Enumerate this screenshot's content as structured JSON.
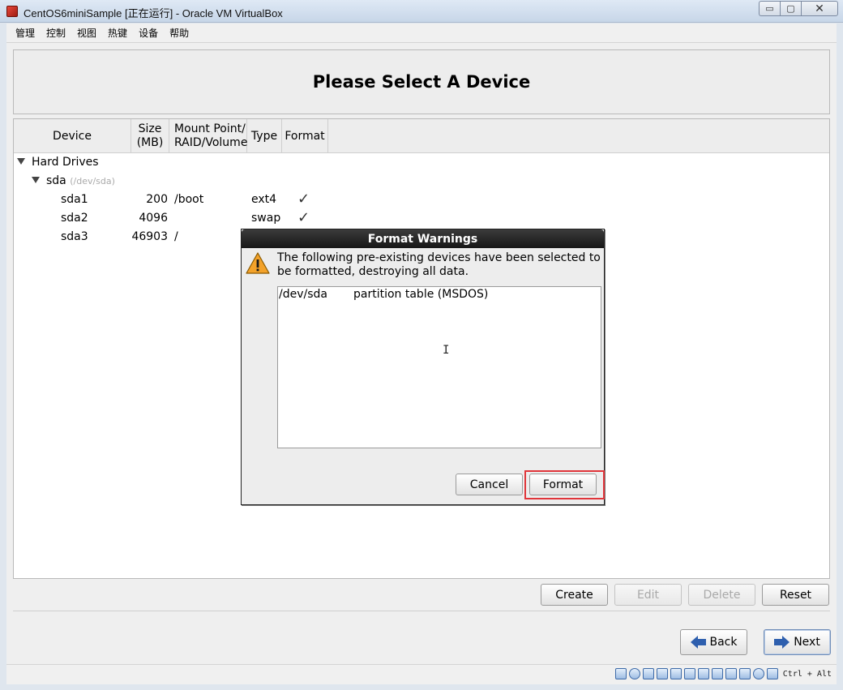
{
  "window": {
    "title": "CentOS6miniSample [正在运行] - Oracle VM VirtualBox",
    "minimize_glyph": "▭",
    "maximize_glyph": "▢",
    "close_glyph": "✕"
  },
  "menubar": {
    "items": [
      "管理",
      "控制",
      "视图",
      "热键",
      "设备",
      "帮助"
    ]
  },
  "header": {
    "title": "Please Select A Device"
  },
  "table": {
    "columns": {
      "device": "Device",
      "size": "Size\n(MB)",
      "mount": "Mount Point/\nRAID/Volume",
      "type": "Type",
      "format": "Format"
    },
    "group": "Hard Drives",
    "disk": {
      "name": "sda",
      "path": "(/dev/sda)"
    },
    "partitions": [
      {
        "name": "sda1",
        "size": "200",
        "mount": "/boot",
        "type": "ext4",
        "format": "✓"
      },
      {
        "name": "sda2",
        "size": "4096",
        "mount": "",
        "type": "swap",
        "format": "✓"
      },
      {
        "name": "sda3",
        "size": "46903",
        "mount": "/",
        "type": "",
        "format": ""
      }
    ]
  },
  "actions": {
    "create": "Create",
    "edit": "Edit",
    "delete": "Delete",
    "reset": "Reset"
  },
  "nav": {
    "back": "Back",
    "next": "Next"
  },
  "dialog": {
    "title": "Format Warnings",
    "message": "The following pre-existing devices have been selected to be formatted, destroying all data.",
    "list": [
      {
        "device": "/dev/sda",
        "description": "partition table (MSDOS)"
      }
    ],
    "cancel": "Cancel",
    "format": "Format"
  },
  "statusbar": {
    "host_key": "Ctrl + Alt"
  },
  "colors": {
    "highlight": "#e0353a",
    "dialog_title_bg": "#1f1f1f",
    "arrow_blue": "#2e5fae"
  }
}
